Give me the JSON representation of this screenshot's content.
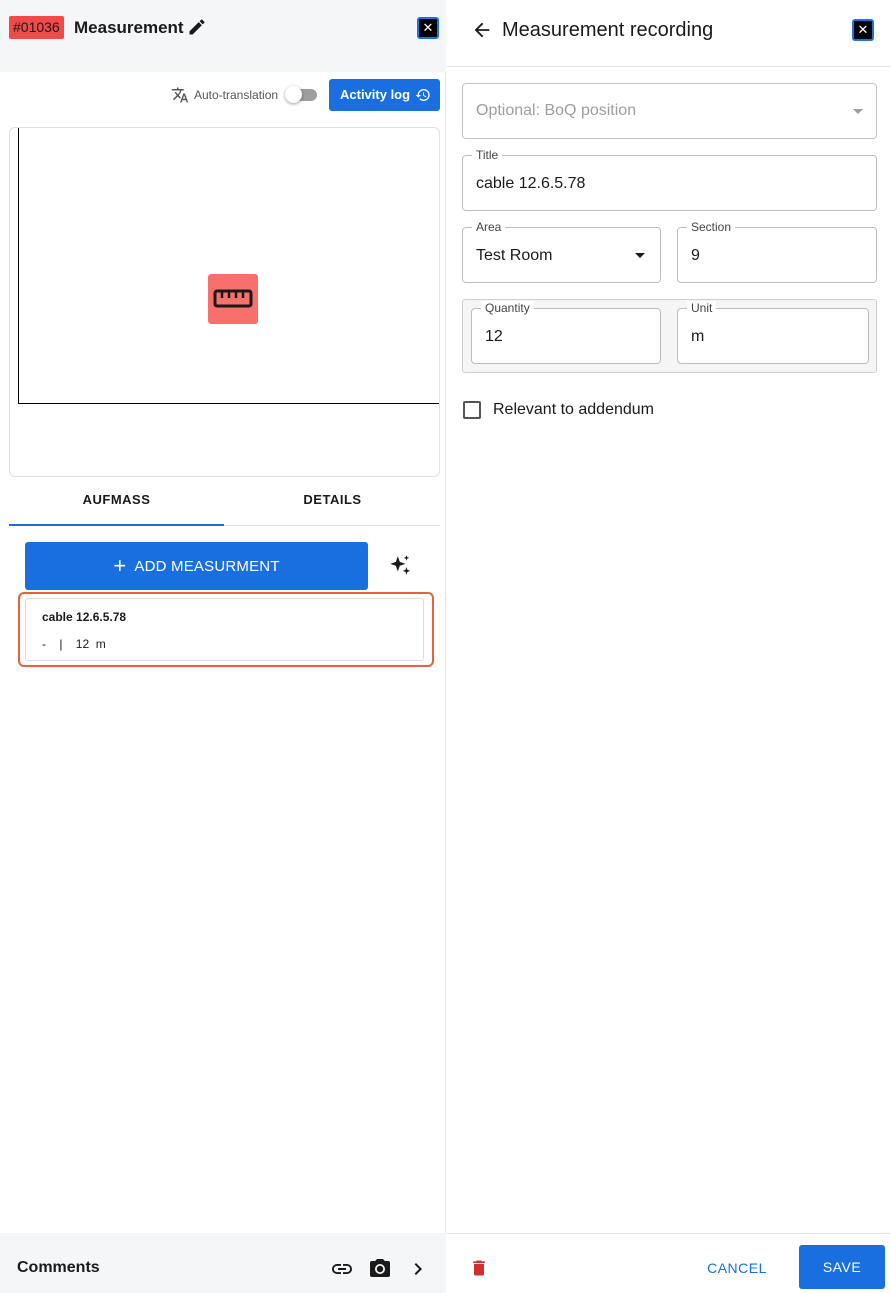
{
  "left_panel": {
    "ticket_id": "#01036",
    "title": "Measurement",
    "auto_translation_label": "Auto-translation",
    "auto_translation_enabled": false,
    "activity_log_label": "Activity log",
    "tabs": [
      {
        "label": "AUFMASS",
        "active": true
      },
      {
        "label": "DETAILS",
        "active": false
      }
    ],
    "add_measurement_label": "ADD MEASURMENT",
    "measurement_item": {
      "title": "cable 12.6.5.78",
      "meta": "-    |    12  m"
    },
    "comments_label": "Comments"
  },
  "right_panel": {
    "title": "Measurement recording",
    "boq": {
      "placeholder": "Optional: BoQ position",
      "value": ""
    },
    "title_field": {
      "label": "Title",
      "value": "cable 12.6.5.78"
    },
    "area": {
      "label": "Area",
      "value": "Test Room"
    },
    "section": {
      "label": "Section",
      "value": "9"
    },
    "quantity": {
      "label": "Quantity",
      "value": "12"
    },
    "unit": {
      "label": "Unit",
      "value": "m"
    },
    "addendum": {
      "label": "Relevant to addendum",
      "checked": false
    },
    "cancel_label": "CANCEL",
    "save_label": "SAVE"
  },
  "colors": {
    "primary": "#1a6fe0",
    "badge": "#f04a4a",
    "marker": "#f7706b",
    "highlight": "#e8613c",
    "delete": "#d32f2f"
  },
  "icons": [
    "edit-icon",
    "close-icon",
    "translate-icon",
    "history-icon",
    "ruler-icon",
    "sparkle-icon",
    "link-icon",
    "camera-icon",
    "chevron-right-icon",
    "arrow-back-icon",
    "trash-icon"
  ]
}
